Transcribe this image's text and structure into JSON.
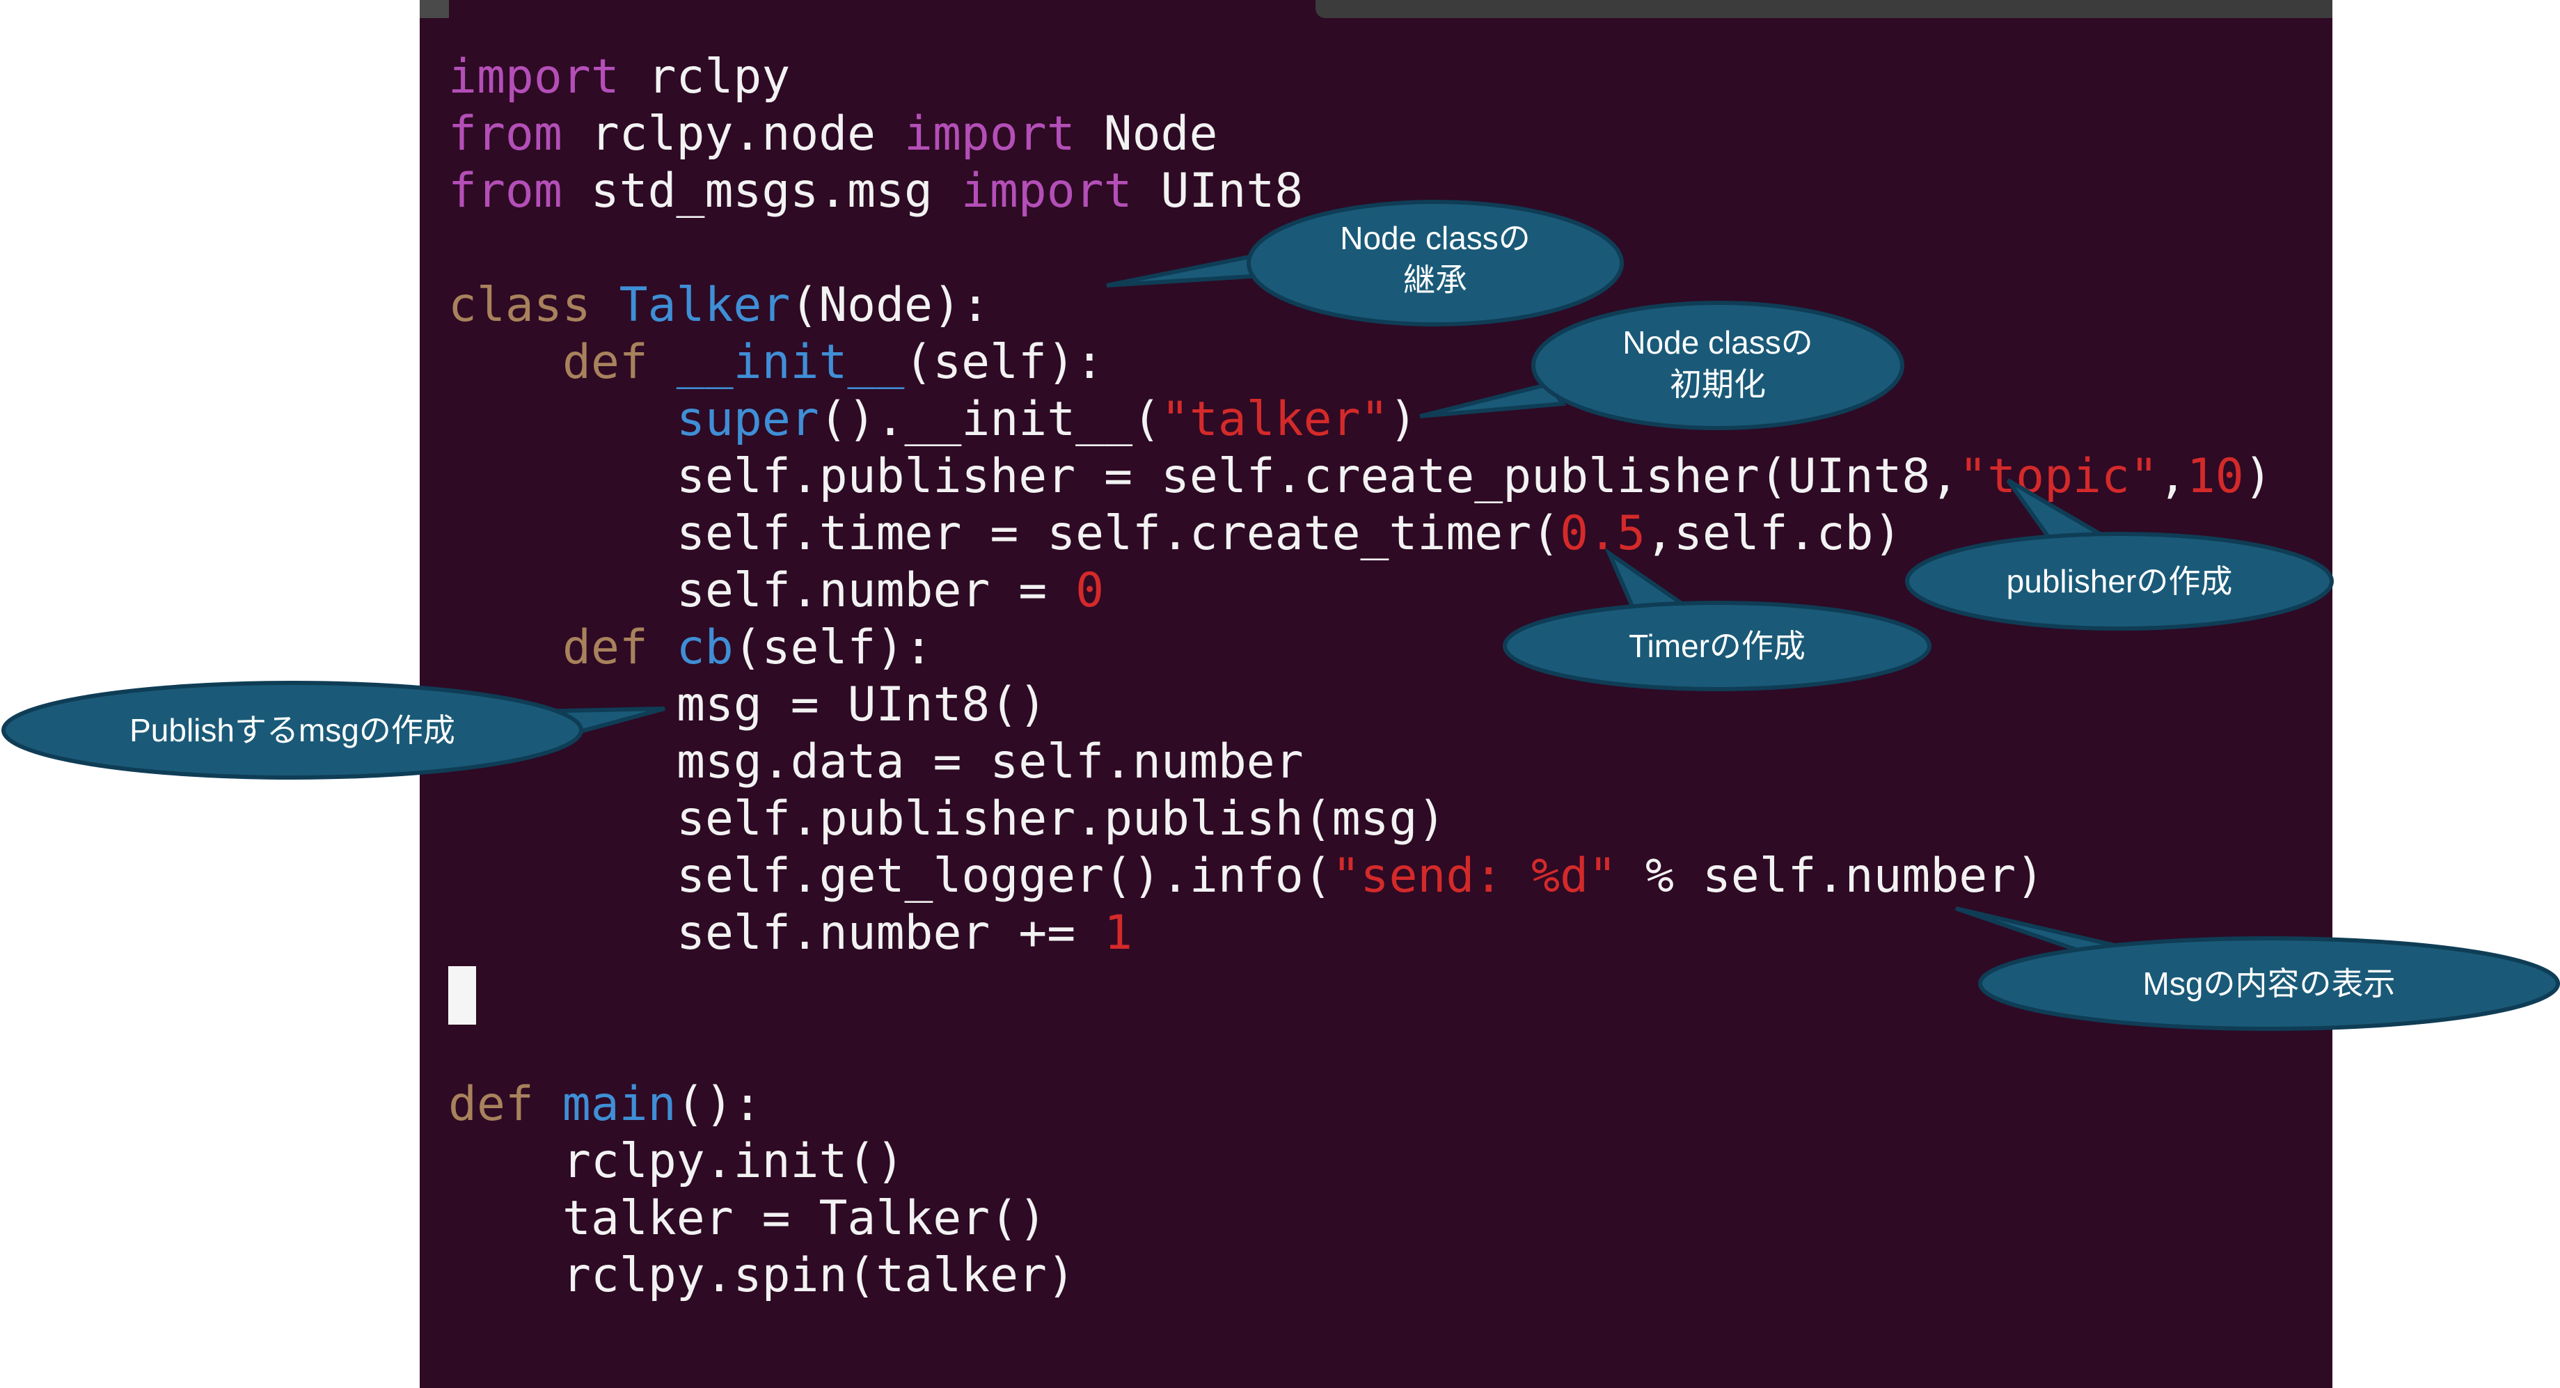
{
  "editor": {
    "code_lines": [
      {
        "indent": 0,
        "tokens": [
          {
            "t": "import",
            "c": "kw-purple"
          },
          {
            "t": " rclpy",
            "c": "plain"
          }
        ]
      },
      {
        "indent": 0,
        "tokens": [
          {
            "t": "from",
            "c": "kw-purple"
          },
          {
            "t": " rclpy.node ",
            "c": "plain"
          },
          {
            "t": "import",
            "c": "kw-purple"
          },
          {
            "t": " Node",
            "c": "plain"
          }
        ]
      },
      {
        "indent": 0,
        "tokens": [
          {
            "t": "from",
            "c": "kw-purple"
          },
          {
            "t": " std_msgs.msg ",
            "c": "plain"
          },
          {
            "t": "import",
            "c": "kw-purple"
          },
          {
            "t": " UInt8",
            "c": "plain"
          }
        ]
      },
      {
        "indent": 0,
        "tokens": []
      },
      {
        "indent": 0,
        "tokens": [
          {
            "t": "class",
            "c": "kw-brown"
          },
          {
            "t": " ",
            "c": "plain"
          },
          {
            "t": "Talker",
            "c": "fn-blue"
          },
          {
            "t": "(Node):",
            "c": "plain"
          }
        ]
      },
      {
        "indent": 1,
        "tokens": [
          {
            "t": "def",
            "c": "kw-brown"
          },
          {
            "t": " ",
            "c": "plain"
          },
          {
            "t": "__init__",
            "c": "fn-blue"
          },
          {
            "t": "(self):",
            "c": "plain"
          }
        ]
      },
      {
        "indent": 2,
        "tokens": [
          {
            "t": "super",
            "c": "fn-blue"
          },
          {
            "t": "().__init__(",
            "c": "plain"
          },
          {
            "t": "\"talker\"",
            "c": "str-red"
          },
          {
            "t": ")",
            "c": "plain"
          }
        ]
      },
      {
        "indent": 2,
        "tokens": [
          {
            "t": "self.publisher = self.create_publisher(UInt8,",
            "c": "plain"
          },
          {
            "t": "\"topic\"",
            "c": "str-red"
          },
          {
            "t": ",",
            "c": "plain"
          },
          {
            "t": "10",
            "c": "num-red"
          },
          {
            "t": ")",
            "c": "plain"
          }
        ]
      },
      {
        "indent": 2,
        "tokens": [
          {
            "t": "self.timer = self.create_timer(",
            "c": "plain"
          },
          {
            "t": "0.5",
            "c": "num-red"
          },
          {
            "t": ",self.cb)",
            "c": "plain"
          }
        ]
      },
      {
        "indent": 2,
        "tokens": [
          {
            "t": "self.number = ",
            "c": "plain"
          },
          {
            "t": "0",
            "c": "num-red"
          }
        ]
      },
      {
        "indent": 1,
        "tokens": [
          {
            "t": "def",
            "c": "kw-brown"
          },
          {
            "t": " ",
            "c": "plain"
          },
          {
            "t": "cb",
            "c": "fn-blue"
          },
          {
            "t": "(self):",
            "c": "plain"
          }
        ]
      },
      {
        "indent": 2,
        "tokens": [
          {
            "t": "msg = UInt8()",
            "c": "plain"
          }
        ]
      },
      {
        "indent": 2,
        "tokens": [
          {
            "t": "msg.data = self.number",
            "c": "plain"
          }
        ]
      },
      {
        "indent": 2,
        "tokens": [
          {
            "t": "self.publisher.publish(msg)",
            "c": "plain"
          }
        ]
      },
      {
        "indent": 2,
        "tokens": [
          {
            "t": "self.get_logger().info(",
            "c": "plain"
          },
          {
            "t": "\"send: %d\"",
            "c": "str-red"
          },
          {
            "t": " % self.number)",
            "c": "plain"
          }
        ]
      },
      {
        "indent": 2,
        "tokens": [
          {
            "t": "self.number += ",
            "c": "plain"
          },
          {
            "t": "1",
            "c": "num-red"
          }
        ]
      },
      {
        "indent": 0,
        "tokens": []
      },
      {
        "indent": 0,
        "tokens": []
      },
      {
        "indent": 0,
        "tokens": [
          {
            "t": "def",
            "c": "kw-brown"
          },
          {
            "t": " ",
            "c": "plain"
          },
          {
            "t": "main",
            "c": "fn-blue"
          },
          {
            "t": "():",
            "c": "plain"
          }
        ]
      },
      {
        "indent": 1,
        "tokens": [
          {
            "t": "rclpy.init()",
            "c": "plain"
          }
        ]
      },
      {
        "indent": 1,
        "tokens": [
          {
            "t": "talker = Talker()",
            "c": "plain"
          }
        ]
      },
      {
        "indent": 1,
        "tokens": [
          {
            "t": "rclpy.spin(talker)",
            "c": "plain"
          }
        ]
      }
    ]
  },
  "annotations": {
    "node_class_inherit": [
      "Node classの",
      "継承"
    ],
    "node_class_init": [
      "Node classの",
      "初期化"
    ],
    "publisher_create": [
      "publisherの作成"
    ],
    "timer_create": [
      "Timerの作成"
    ],
    "publish_msg_create": [
      "Publishするmsgの作成"
    ],
    "msg_display": [
      "Msgの内容の表示"
    ]
  },
  "colors": {
    "terminal_bg": "#2e0a24",
    "callout_fill": "#1a5a78",
    "callout_stroke": "#0f3d56"
  }
}
